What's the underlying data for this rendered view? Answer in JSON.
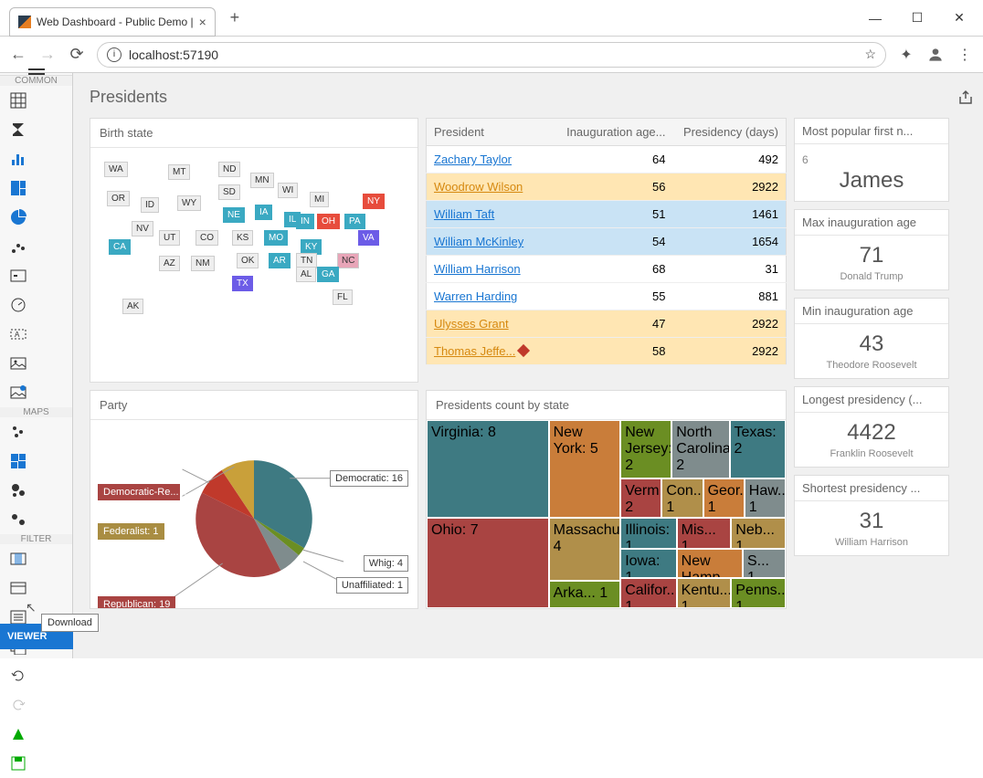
{
  "browser": {
    "tab_title": "Web Dashboard - Public Demo |",
    "url": "localhost:57190"
  },
  "sidebar": {
    "sections": [
      "COMMON",
      "MAPS",
      "FILTER"
    ],
    "viewer": "VIEWER",
    "tooltip": "Download"
  },
  "page": {
    "title": "Presidents"
  },
  "map": {
    "title": "Birth state"
  },
  "table": {
    "headers": [
      "President",
      "Inauguration age...",
      "Presidency (days)"
    ],
    "rows": [
      {
        "name": "Zachary Taylor",
        "age": "64",
        "days": "492",
        "cls": ""
      },
      {
        "name": "Woodrow Wilson",
        "age": "56",
        "days": "2922",
        "cls": "hl"
      },
      {
        "name": "William Taft",
        "age": "51",
        "days": "1461",
        "cls": "bl"
      },
      {
        "name": "William McKinley",
        "age": "54",
        "days": "1654",
        "cls": "bl"
      },
      {
        "name": "William Harrison",
        "age": "68",
        "days": "31",
        "cls": ""
      },
      {
        "name": "Warren Harding",
        "age": "55",
        "days": "881",
        "cls": ""
      },
      {
        "name": "Ulysses Grant",
        "age": "47",
        "days": "2922",
        "cls": "hl"
      },
      {
        "name": "Thomas Jeffe...",
        "age": "58",
        "days": "2922",
        "cls": "hl",
        "diamond": true
      }
    ]
  },
  "kpis": [
    {
      "title": "Most popular first n...",
      "sup": "6",
      "value": "James",
      "sub": ""
    },
    {
      "title": "Max inauguration age",
      "value": "71",
      "sub": "Donald Trump"
    },
    {
      "title": "Min inauguration age",
      "value": "43",
      "sub": "Theodore Roosevelt"
    },
    {
      "title": "Longest presidency (...",
      "value": "4422",
      "sub": "Franklin Roosevelt"
    },
    {
      "title": "Shortest presidency ...",
      "value": "31",
      "sub": "William Harrison"
    }
  ],
  "pie": {
    "title": "Party"
  },
  "tree": {
    "title": "Presidents count by state"
  },
  "chart_data": [
    {
      "type": "pie",
      "title": "Party",
      "series": [
        {
          "name": "Republican",
          "value": 19,
          "color": "#a94442"
        },
        {
          "name": "Democratic",
          "value": 16,
          "color": "#3e7a82"
        },
        {
          "name": "Democratic-Re...",
          "value": 4,
          "color": "#c0392b"
        },
        {
          "name": "Whig",
          "value": 4,
          "color": "#7f8c8d"
        },
        {
          "name": "Federalist",
          "value": 1,
          "color": "#a98d42"
        },
        {
          "name": "Unaffiliated",
          "value": 1,
          "color": "#6b8e23"
        }
      ]
    },
    {
      "type": "treemap",
      "title": "Presidents count by state",
      "series": [
        {
          "name": "Virginia",
          "value": 8,
          "color": "#3e7a82"
        },
        {
          "name": "Ohio",
          "value": 7,
          "color": "#a94442"
        },
        {
          "name": "New York",
          "value": 5,
          "color": "#c97d3a"
        },
        {
          "name": "Massachus...",
          "value": 4,
          "color": "#b08f4a"
        },
        {
          "name": "New Jersey",
          "value": 2,
          "color": "#6b8e23"
        },
        {
          "name": "North Carolina",
          "value": 2,
          "color": "#7f8c8d"
        },
        {
          "name": "Texas",
          "value": 2,
          "color": "#3e7a82"
        },
        {
          "name": "Verm...",
          "value": 2,
          "color": "#a94442"
        },
        {
          "name": "Arka...",
          "value": 1,
          "color": "#6b8e23"
        },
        {
          "name": "Califor...",
          "value": 1,
          "color": "#a94442"
        },
        {
          "name": "Con...",
          "value": 1,
          "color": "#b08f4a"
        },
        {
          "name": "Geor...",
          "value": 1,
          "color": "#c97d3a"
        },
        {
          "name": "Haw...",
          "value": 1,
          "color": "#7f8c8d"
        },
        {
          "name": "Illinois",
          "value": 1,
          "color": "#3e7a82"
        },
        {
          "name": "Iowa",
          "value": 1,
          "color": "#3e7a82"
        },
        {
          "name": "Kentu...",
          "value": 1,
          "color": "#b08f4a"
        },
        {
          "name": "Mis...",
          "value": 1,
          "color": "#a94442"
        },
        {
          "name": "Neb...",
          "value": 1,
          "color": "#b08f4a"
        },
        {
          "name": "New Hamp...",
          "value": 1,
          "color": "#c97d3a"
        },
        {
          "name": "Penns...",
          "value": 1,
          "color": "#6b8e23"
        },
        {
          "name": "S...",
          "value": 1,
          "color": "#7f8c8d"
        }
      ]
    },
    {
      "type": "map",
      "title": "Birth state",
      "states": [
        {
          "id": "WA",
          "color": "gray"
        },
        {
          "id": "MT",
          "color": "gray"
        },
        {
          "id": "ND",
          "color": "gray"
        },
        {
          "id": "MN",
          "color": "gray"
        },
        {
          "id": "OR",
          "color": "gray"
        },
        {
          "id": "ID",
          "color": "gray"
        },
        {
          "id": "SD",
          "color": "gray"
        },
        {
          "id": "WI",
          "color": "gray"
        },
        {
          "id": "MI",
          "color": "gray"
        },
        {
          "id": "NY",
          "color": "red"
        },
        {
          "id": "WY",
          "color": "gray"
        },
        {
          "id": "NE",
          "color": "teal"
        },
        {
          "id": "IA",
          "color": "teal"
        },
        {
          "id": "IL",
          "color": "teal"
        },
        {
          "id": "IN",
          "color": "teal"
        },
        {
          "id": "OH",
          "color": "red"
        },
        {
          "id": "PA",
          "color": "teal"
        },
        {
          "id": "NV",
          "color": "gray"
        },
        {
          "id": "UT",
          "color": "gray"
        },
        {
          "id": "CO",
          "color": "gray"
        },
        {
          "id": "KS",
          "color": "gray"
        },
        {
          "id": "MO",
          "color": "teal"
        },
        {
          "id": "KY",
          "color": "teal"
        },
        {
          "id": "VA",
          "color": "blue"
        },
        {
          "id": "CA",
          "color": "teal"
        },
        {
          "id": "AZ",
          "color": "gray"
        },
        {
          "id": "NM",
          "color": "gray"
        },
        {
          "id": "OK",
          "color": "gray"
        },
        {
          "id": "AR",
          "color": "teal"
        },
        {
          "id": "TN",
          "color": "gray"
        },
        {
          "id": "NC",
          "color": "pink"
        },
        {
          "id": "TX",
          "color": "blue"
        },
        {
          "id": "AL",
          "color": "gray"
        },
        {
          "id": "GA",
          "color": "teal"
        },
        {
          "id": "FL",
          "color": "gray"
        },
        {
          "id": "AK",
          "color": "gray"
        }
      ]
    }
  ]
}
